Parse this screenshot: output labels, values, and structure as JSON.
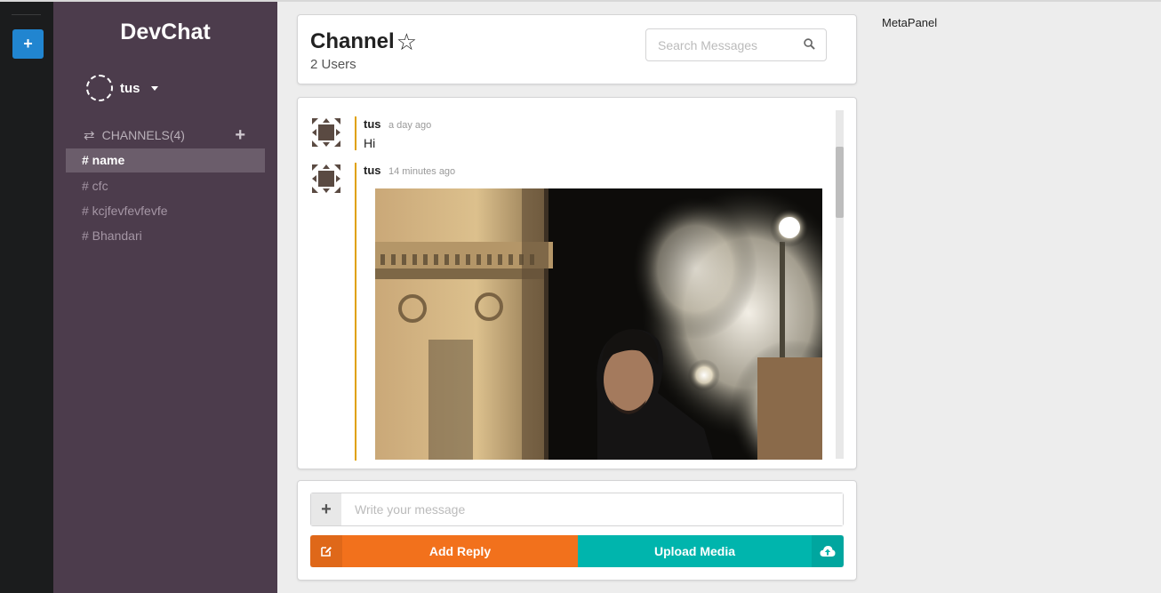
{
  "color_panel": {
    "add_label": "+"
  },
  "sidebar": {
    "brand": "DevChat",
    "user_name": "tus",
    "channels_header": "CHANNELS(4)",
    "add_channel_label": "+",
    "channels": [
      {
        "label": "# name",
        "active": true
      },
      {
        "label": "# cfc",
        "active": false
      },
      {
        "label": "# kcjfevfevfevfe",
        "active": false
      },
      {
        "label": "# Bhandari",
        "active": false
      }
    ]
  },
  "header": {
    "channel_name": "Channel",
    "star_icon": "star-outline-icon",
    "users_count": "2 Users",
    "search_placeholder": "Search Messages"
  },
  "messages": [
    {
      "author": "tus",
      "time": "a day ago",
      "text": "Hi"
    },
    {
      "author": "tus",
      "time": "14 minutes ago",
      "image": "photo of man at night by illuminated stone pillar"
    }
  ],
  "form": {
    "add_label": "+",
    "input_placeholder": "Write your message",
    "reply_label": "Add Reply",
    "upload_label": "Upload Media"
  },
  "meta_panel": {
    "title": "MetaPanel"
  },
  "colors": {
    "strip": "#1b1c1d",
    "sidebar": "#4c3c4c",
    "active_channel": "#6b5d6b",
    "reply": "#f2711c",
    "upload": "#00b5ad",
    "message_border": "#e0a100"
  }
}
